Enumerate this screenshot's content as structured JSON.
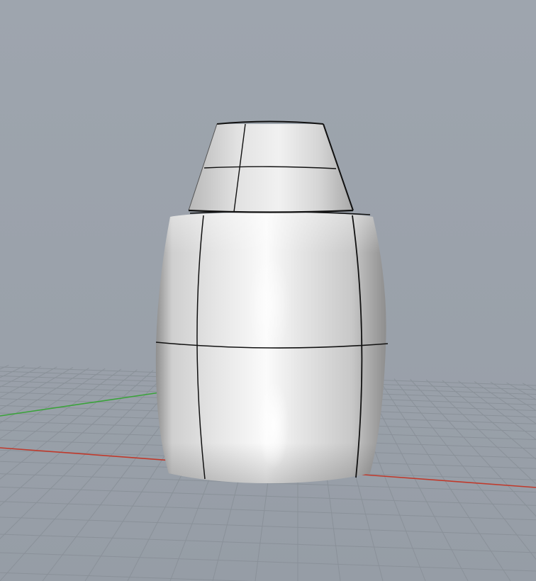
{
  "viewport": {
    "kind": "perspective-3d-viewport",
    "background_color": "#9aa1aa",
    "grid_color": "#8a9199",
    "x_axis_color": "#c0392b",
    "y_axis_color": "#3aa33a",
    "curve_color": "#000000"
  },
  "model": {
    "object": "revolved-surface",
    "parts": [
      "frustum-cap",
      "barrel-body"
    ]
  }
}
